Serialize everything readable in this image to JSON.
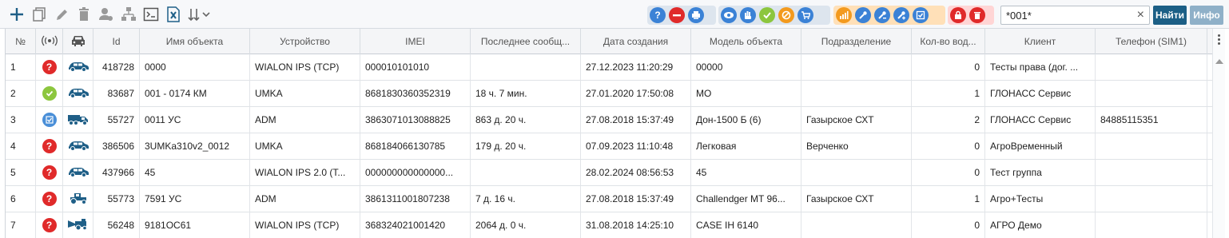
{
  "toolbar": {
    "left_icons": [
      "plus-icon",
      "copy-icon",
      "pencil-icon",
      "trash-icon",
      "user-gear-icon",
      "hierarchy-icon",
      "console-icon",
      "excel-icon",
      "sort-icon"
    ],
    "group_blue_1": [
      "help-icon",
      "minus-circle-icon",
      "print-icon"
    ],
    "group_blue_2": [
      "eye-icon",
      "hand-icon",
      "check-icon",
      "forbidden-icon",
      "cart-icon"
    ],
    "group_orange": [
      "chart-icon",
      "wrench-icon",
      "wrench-list-icon",
      "wrench-add-icon",
      "checklist-icon"
    ],
    "group_red": [
      "lock-icon",
      "trash-red-icon"
    ],
    "colors": {
      "blue": "#3b82d6",
      "red": "#e02a2a",
      "orange": "#f39a1e",
      "green": "#8cc63e",
      "find_button": "#1c5f86",
      "info_button": "#8fb0c8"
    }
  },
  "search": {
    "value": "*001*",
    "clear": "×"
  },
  "buttons": {
    "find": "Найти",
    "info": "Инфо"
  },
  "columns": [
    {
      "key": "n",
      "label": "№"
    },
    {
      "key": "signal",
      "label": "((•))"
    },
    {
      "key": "type",
      "label": ""
    },
    {
      "key": "id",
      "label": "Id"
    },
    {
      "key": "name",
      "label": "Имя объекта"
    },
    {
      "key": "device",
      "label": "Устройство"
    },
    {
      "key": "imei",
      "label": "IMEI"
    },
    {
      "key": "last_msg",
      "label": "Последнее сообщ..."
    },
    {
      "key": "created",
      "label": "Дата создания"
    },
    {
      "key": "model",
      "label": "Модель объекта"
    },
    {
      "key": "division",
      "label": "Подразделение"
    },
    {
      "key": "drivers",
      "label": "Кол-во вод..."
    },
    {
      "key": "client",
      "label": "Клиент"
    },
    {
      "key": "phone",
      "label": "Телефон (SIM1)"
    }
  ],
  "rows": [
    {
      "n": "1",
      "status": "unknown",
      "vehicle": "car",
      "id": "418728",
      "name": "0000",
      "device": "WIALON IPS (TCP)",
      "imei": "000010101010",
      "last_msg": "",
      "created": "27.12.2023 11:20:29",
      "model": "00000",
      "division": "",
      "drivers": "0",
      "client": "Тесты права (дог. ...",
      "phone": ""
    },
    {
      "n": "2",
      "status": "ok",
      "vehicle": "car",
      "id": "83687",
      "name": "001 - 0174 КМ",
      "device": "UMKA",
      "imei": "8681830360352319",
      "last_msg": "18 ч. 7 мин.",
      "created": "27.01.2020 17:50:08",
      "model": "МО",
      "division": "",
      "drivers": "1",
      "client": "ГЛОНАСС Сервис",
      "phone": ""
    },
    {
      "n": "3",
      "status": "edit",
      "vehicle": "truck",
      "id": "55727",
      "name": "0011 УС",
      "device": "ADM",
      "imei": "3863071013088825",
      "last_msg": "863 д. 20 ч.",
      "created": "27.08.2018 15:37:49",
      "model": "Дон-1500 Б (6)",
      "division": "Газырское СХТ",
      "drivers": "2",
      "client": "ГЛОНАСС Сервис",
      "phone": "84885115351"
    },
    {
      "n": "4",
      "status": "unknown",
      "vehicle": "car",
      "id": "386506",
      "name": "3UMKa310v2_0012",
      "device": "UMKA",
      "imei": "868184066130785",
      "last_msg": "179 д. 20 ч.",
      "created": "07.09.2023 11:10:48",
      "model": "Легковая",
      "division": "Верченко",
      "drivers": "0",
      "client": "АгроВременный",
      "phone": ""
    },
    {
      "n": "5",
      "status": "unknown",
      "vehicle": "car",
      "id": "437966",
      "name": "45",
      "device": "WIALON IPS 2.0 (T...",
      "imei": "000000000000000...",
      "last_msg": "",
      "created": "28.02.2024 08:56:53",
      "model": "45",
      "division": "",
      "drivers": "0",
      "client": "Тест группа",
      "phone": ""
    },
    {
      "n": "6",
      "status": "unknown",
      "vehicle": "tractor",
      "id": "55773",
      "name": "7591 УС",
      "device": "ADM",
      "imei": "3861311001807238",
      "last_msg": "7 д. 16 ч.",
      "created": "27.08.2018 15:37:49",
      "model": "Challendger MT 96...",
      "division": "Газырское СХТ",
      "drivers": "1",
      "client": "Агро+Тесты",
      "phone": ""
    },
    {
      "n": "7",
      "status": "unknown",
      "vehicle": "harvester",
      "id": "56248",
      "name": "9181ОС61",
      "device": "WIALON IPS (TCP)",
      "imei": "368324021001420",
      "last_msg": "2064 д. 0 ч.",
      "created": "31.08.2018 14:25:10",
      "model": "CASE IH 6140",
      "division": "",
      "drivers": "0",
      "client": "АГРО Демо",
      "phone": ""
    }
  ]
}
